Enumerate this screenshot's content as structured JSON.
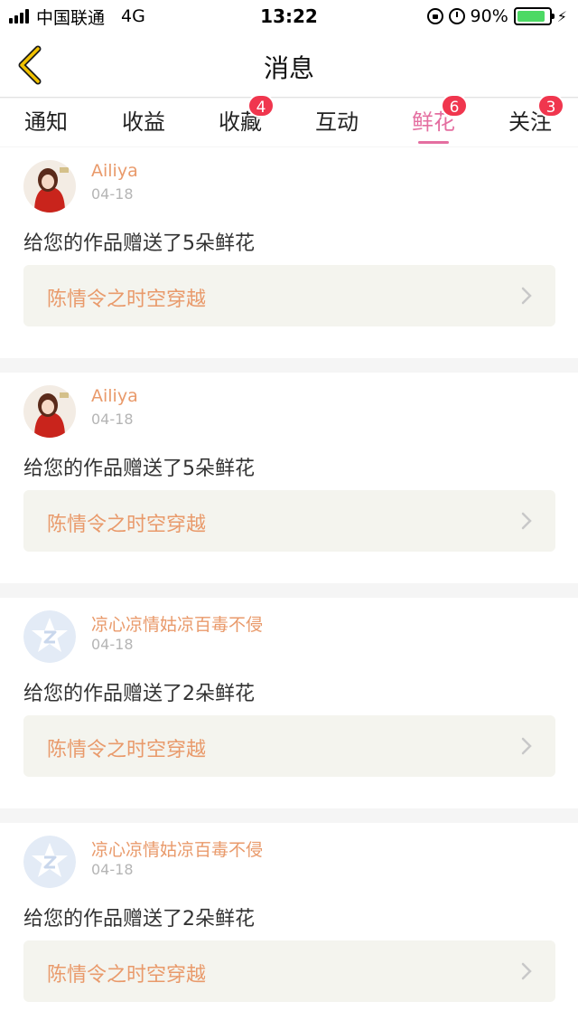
{
  "status_bar": {
    "carrier": "中国联通",
    "network": "4G",
    "time": "13:22",
    "battery_percent": "90%",
    "battery_level": 0.9,
    "icons": [
      "signal-icon",
      "lock-rotation-icon",
      "alarm-icon",
      "battery-icon",
      "charging-icon"
    ]
  },
  "nav": {
    "title": "消息",
    "back_icon": "chevron-left-icon"
  },
  "tabs": [
    {
      "label": "通知",
      "badge": ""
    },
    {
      "label": "收益",
      "badge": ""
    },
    {
      "label": "收藏",
      "badge": "4"
    },
    {
      "label": "互动",
      "badge": ""
    },
    {
      "label": "鲜花",
      "badge": "6",
      "active": true
    },
    {
      "label": "关注",
      "badge": "3"
    }
  ],
  "colors": {
    "accent": "#e46ea0",
    "badge": "#f0364e",
    "username": "#e99a6b",
    "link_bg": "#f4f4ee"
  },
  "messages": [
    {
      "user": "Ailiya",
      "date": "04-18",
      "text": "给您的作品赠送了5朵鲜花",
      "work": "陈情令之时空穿越",
      "avatar": "photo-avatar"
    },
    {
      "user": "Ailiya",
      "date": "04-18",
      "text": "给您的作品赠送了5朵鲜花",
      "work": "陈情令之时空穿越",
      "avatar": "photo-avatar"
    },
    {
      "user": "凉心凉情姑凉百毒不侵",
      "date": "04-18",
      "text": "给您的作品赠送了2朵鲜花",
      "work": "陈情令之时空穿越",
      "avatar": "qq-default-avatar"
    },
    {
      "user": "凉心凉情姑凉百毒不侵",
      "date": "04-18",
      "text": "给您的作品赠送了2朵鲜花",
      "work": "陈情令之时空穿越",
      "avatar": "qq-default-avatar"
    }
  ]
}
